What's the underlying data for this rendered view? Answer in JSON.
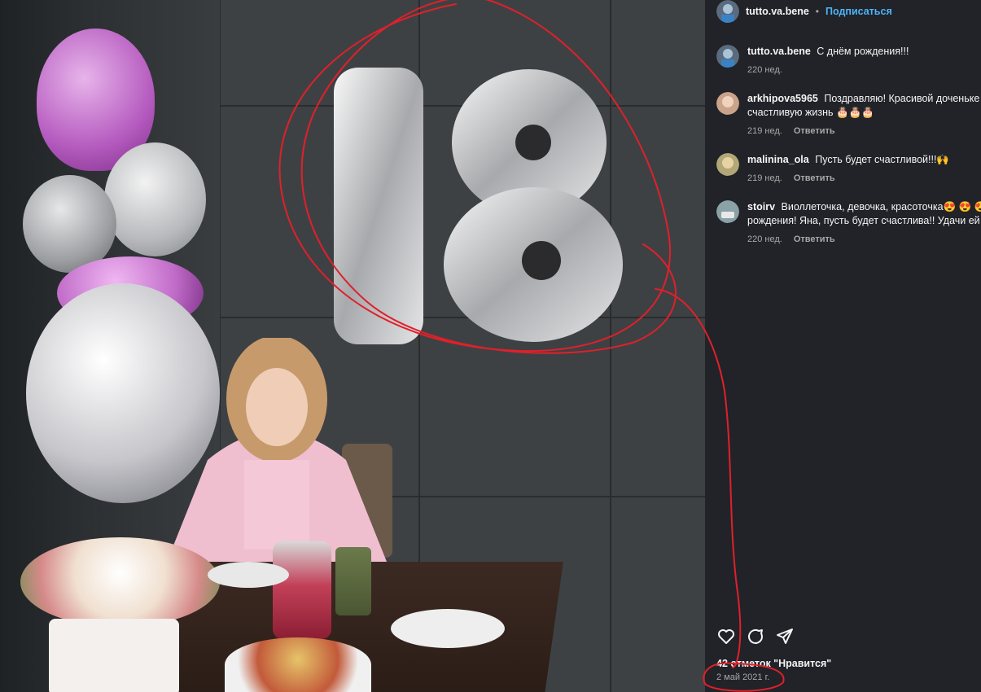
{
  "post": {
    "author": "tutto.va.bene",
    "separator": "•",
    "follow_label": "Подписаться",
    "likes_text": "42 отметок \"Нравится\"",
    "date": "2 май 2021 г."
  },
  "comments": [
    {
      "user": "tutto.va.bene",
      "text": "С днём рождения!!!",
      "age": "220 нед.",
      "reply": ""
    },
    {
      "user": "arkhipova5965",
      "text": "Поздравляю! Красивой доченьке счастливую жизнь 🎂🎂🎂",
      "age": "219 нед.",
      "reply": "Ответить"
    },
    {
      "user": "malinina_ola",
      "text": "Пусть будет счастливой!!!🙌",
      "age": "219 нед.",
      "reply": "Ответить"
    },
    {
      "user": "stoirv",
      "text": "Виоллеточка, девочка, красоточка😍 😍 😍 рождения! Яна, пусть будет счастлива!! Удачи ей",
      "age": "220 нед.",
      "reply": "Ответить"
    }
  ],
  "icons": {
    "like": "heart-icon",
    "comment": "comment-icon",
    "share": "share-icon"
  },
  "colors": {
    "panel_bg": "#212328",
    "link_blue": "#4cb5f9",
    "annotation_red": "#e0202a"
  }
}
